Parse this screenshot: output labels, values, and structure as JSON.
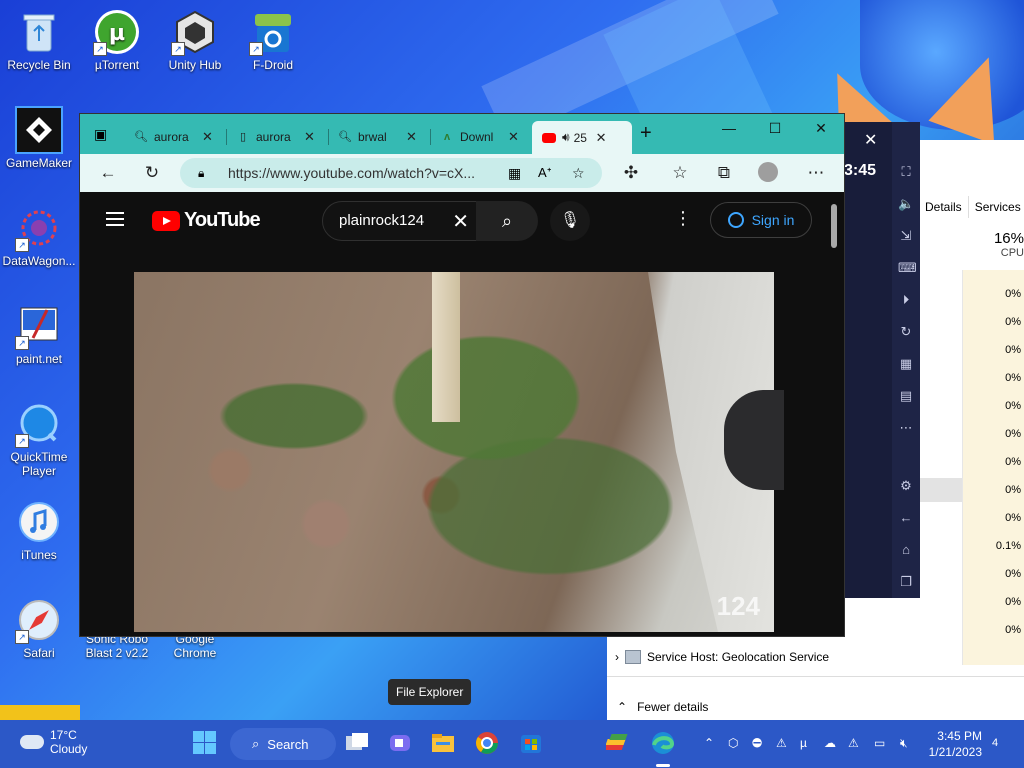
{
  "desktop": {
    "icons": [
      {
        "label": "Recycle Bin"
      },
      {
        "label": "µTorrent"
      },
      {
        "label": "Unity Hub"
      },
      {
        "label": "F-Droid"
      },
      {
        "label": "GameMaker"
      },
      {
        "label": "DataWagon..."
      },
      {
        "label": "paint.net"
      },
      {
        "label": "QuickTime Player"
      },
      {
        "label": "iTunes"
      },
      {
        "label": "Safari"
      },
      {
        "label": "Sonic Robo Blast 2 v2.2"
      },
      {
        "label": "Google Chrome"
      }
    ]
  },
  "task_manager": {
    "tabs": [
      "Details",
      "Services"
    ],
    "cpu_percent": "16%",
    "cpu_label": "CPU",
    "values": [
      "0%",
      "0%",
      "0%",
      "0%",
      "0%",
      "0%",
      "0%",
      "0%",
      "0%",
      "0.1%",
      "0%",
      "0%",
      "0%"
    ],
    "service_row": "Service Host: Geolocation Service",
    "fewer_details": "Fewer details"
  },
  "emulator": {
    "time": "3:45"
  },
  "browser": {
    "tabs": [
      {
        "title": "aurora",
        "icon": "search-icon"
      },
      {
        "title": "aurora",
        "icon": "page-icon"
      },
      {
        "title": "brwal",
        "icon": "search-icon"
      },
      {
        "title": "Downl",
        "icon": "android-icon"
      },
      {
        "title": "25",
        "icon": "youtube-icon",
        "active": true
      }
    ],
    "url": "https://www.youtube.com/watch?v=cX...",
    "colors": {
      "tabstrip": "#35bab3",
      "toolbar": "#e8f7f6"
    }
  },
  "youtube": {
    "logo_text": "YouTube",
    "search_query": "plainrock124",
    "sign_in": "Sign in",
    "video_watermark": "124"
  },
  "tooltip": "File Explorer",
  "taskbar": {
    "weather_temp": "17°C",
    "weather_desc": "Cloudy",
    "search_label": "Search",
    "time": "3:45 PM",
    "date": "1/21/2023",
    "notifications": "4"
  }
}
